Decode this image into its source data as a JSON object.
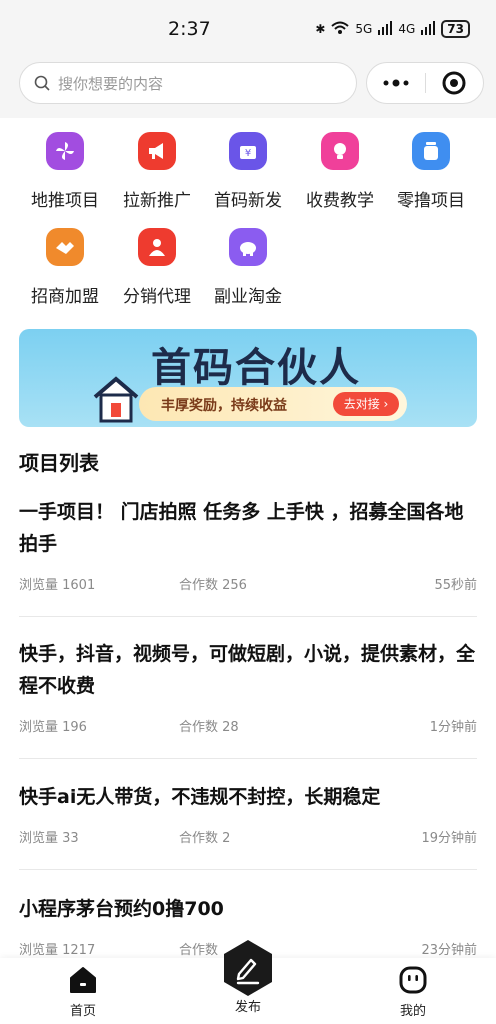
{
  "status_bar": {
    "time": "2:37",
    "network_5g": "5G",
    "network_4g": "4G",
    "battery": "73"
  },
  "search": {
    "placeholder": "搜你想要的内容"
  },
  "categories": [
    {
      "label": "地推项目",
      "icon": "pinwheel-icon",
      "color": "#a24de0"
    },
    {
      "label": "拉新推广",
      "icon": "megaphone-icon",
      "color": "#ee3b2f"
    },
    {
      "label": "首码新发",
      "icon": "yuan-box-icon",
      "color": "#6a55e8"
    },
    {
      "label": "收费教学",
      "icon": "lightbulb-icon",
      "color": "#f0409a"
    },
    {
      "label": "零撸项目",
      "icon": "jar-icon",
      "color": "#3f8ef0"
    },
    {
      "label": "招商加盟",
      "icon": "handshake-icon",
      "color": "#f08a2c"
    },
    {
      "label": "分销代理",
      "icon": "agent-icon",
      "color": "#ee3b2f"
    },
    {
      "label": "副业淘金",
      "icon": "piggy-bank-icon",
      "color": "#8b5cf0"
    }
  ],
  "banner": {
    "title": "首码合伙人",
    "subtitle": "丰厚奖励，持续收益",
    "button": "去对接 ›"
  },
  "section_title": "项目列表",
  "projects": [
    {
      "title": "一手项目！ 门店拍照 任务多 上手快 ，招募全国各地拍手",
      "views": "浏览量 1601",
      "coop": "合作数 256",
      "time": "55秒前"
    },
    {
      "title": "快手，抖音，视频号，可做短剧，小说，提供素材，全程不收费",
      "views": "浏览量 196",
      "coop": "合作数 28",
      "time": "1分钟前"
    },
    {
      "title": "快手ai无人带货，不违规不封控，长期稳定",
      "views": "浏览量 33",
      "coop": "合作数 2",
      "time": "19分钟前"
    },
    {
      "title": "小程序茅台预约0撸700",
      "views": "浏览量 1217",
      "coop": "合作数",
      "time": "23分钟前"
    }
  ],
  "tabbar": {
    "home": "首页",
    "publish": "发布",
    "mine": "我的"
  }
}
